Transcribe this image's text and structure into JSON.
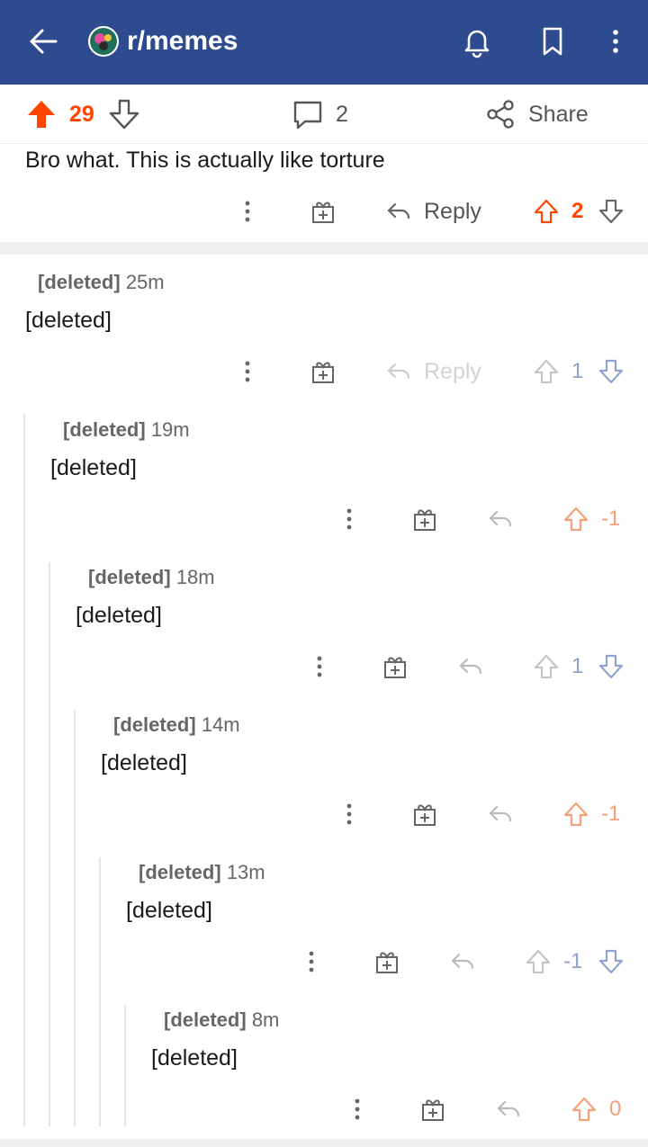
{
  "header": {
    "subreddit": "r/memes",
    "back_icon": "arrow-left-icon",
    "bell_icon": "bell-icon",
    "bookmark_icon": "bookmark-icon",
    "more_icon": "more-vertical-icon",
    "bar_color": "#2e4b8f"
  },
  "post_bar": {
    "score": "29",
    "comment_count": "2",
    "share_label": "Share",
    "upvote_color": "#ff4500"
  },
  "top_comment": {
    "body": "Bro what. This is actually like torture",
    "reply_label": "Reply",
    "score": "2"
  },
  "comments": [
    {
      "author": "[deleted]",
      "age": "25m",
      "body": "[deleted]",
      "reply_label": "Reply",
      "score": "1"
    },
    {
      "author": "[deleted]",
      "age": "19m",
      "body": "[deleted]",
      "score": "-1"
    },
    {
      "author": "[deleted]",
      "age": "18m",
      "body": "[deleted]",
      "score": "1"
    },
    {
      "author": "[deleted]",
      "age": "14m",
      "body": "[deleted]",
      "score": "-1"
    },
    {
      "author": "[deleted]",
      "age": "13m",
      "body": "[deleted]",
      "score": "-1"
    },
    {
      "author": "[deleted]",
      "age": "8m",
      "body": "[deleted]",
      "score": "0"
    }
  ],
  "colors": {
    "orange": "#ff4500",
    "orange_light": "#f4a07a",
    "blue_light": "#8fa3cf",
    "gray": "#555555"
  }
}
